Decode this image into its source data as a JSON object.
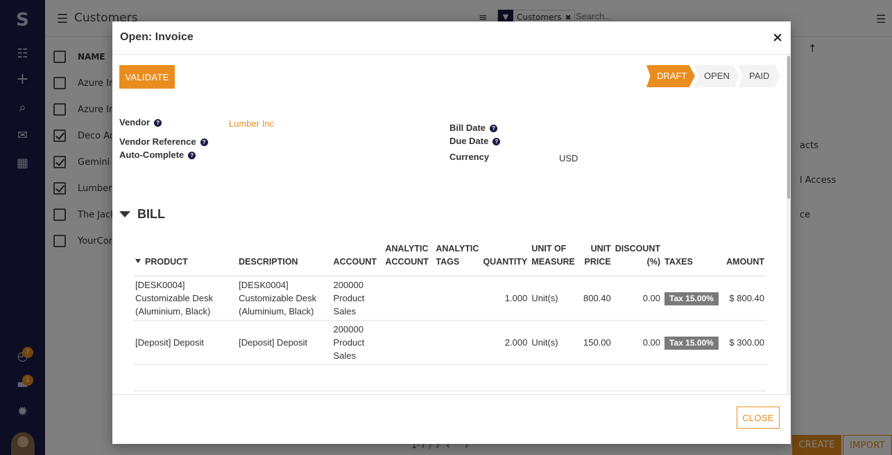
{
  "app": {
    "breadcrumb_title": "Customers",
    "search_facet": "Customers",
    "search_placeholder": "Search...",
    "list": {
      "header": "NAME",
      "rows": [
        {
          "name": "Azure In",
          "checked": false
        },
        {
          "name": "Azure In",
          "checked": false
        },
        {
          "name": "Deco Ad",
          "checked": true
        },
        {
          "name": "Gemini F",
          "checked": true
        },
        {
          "name": "Lumber",
          "checked": true
        },
        {
          "name": "The Jack",
          "checked": false
        },
        {
          "name": "YourCom",
          "checked": false
        }
      ]
    },
    "right_panel": [
      "acts",
      "l Access",
      "ce"
    ],
    "pager": "1-7 / 7",
    "create_label": "CREATE",
    "import_label": "IMPORT",
    "badges": {
      "activity": "7",
      "discuss": "1"
    }
  },
  "modal": {
    "title": "Open: Invoice",
    "validate_label": "VALIDATE",
    "statuses": [
      "DRAFT",
      "OPEN",
      "PAID"
    ],
    "active_status": "DRAFT",
    "fields": {
      "vendor_label": "Vendor",
      "vendor_value": "Lumber Inc",
      "vendor_reference_label": "Vendor Reference",
      "auto_complete_label": "Auto-Complete",
      "bill_date_label": "Bill Date",
      "due_date_label": "Due Date",
      "currency_label": "Currency",
      "currency_value": "USD"
    },
    "section_title": "BILL",
    "table": {
      "headers": {
        "product": "PRODUCT",
        "description": "DESCRIPTION",
        "account": "ACCOUNT",
        "analytic_account_1": "ANALYTIC",
        "analytic_account_2": "ACCOUNT",
        "analytic_tags_1": "ANALYTIC",
        "analytic_tags_2": "TAGS",
        "quantity": "QUANTITY",
        "uom_1": "UNIT OF",
        "uom_2": "MEASURE",
        "unit_price_1": "UNIT",
        "unit_price_2": "PRICE",
        "discount_1": "DISCOUNT",
        "discount_2": "(%)",
        "taxes": "TAXES",
        "amount": "AMOUNT"
      },
      "rows": [
        {
          "product": "[DESK0004] Customizable Desk (Aluminium, Black)",
          "description": "[DESK0004] Customizable Desk (Aluminium, Black)",
          "account": "200000 Product Sales",
          "analytic_account": "",
          "analytic_tags": "",
          "quantity": "1.000",
          "uom": "Unit(s)",
          "unit_price": "800.40",
          "discount": "0.00",
          "tax": "Tax 15.00%",
          "amount": "$ 800.40"
        },
        {
          "product": "[Deposit] Deposit",
          "description": "[Deposit] Deposit",
          "account": "200000 Product Sales",
          "analytic_account": "",
          "analytic_tags": "",
          "quantity": "2.000",
          "uom": "Unit(s)",
          "unit_price": "150.00",
          "discount": "0.00",
          "tax": "Tax 15.00%",
          "amount": "$ 300.00"
        }
      ]
    },
    "close_label": "CLOSE",
    "close_x": "×"
  },
  "icons": {
    "hamburger": "hamburger-icon",
    "sort": "sort-icon",
    "filter": "filter-icon",
    "list_view": "list-view-icon",
    "apps": "apps-icon",
    "plus": "plus-icon",
    "search": "search-icon",
    "mail": "mail-icon",
    "calendar": "calendar-icon",
    "activity": "clock-icon",
    "discuss": "chat-icon",
    "bug": "bug-icon",
    "help": "question-icon"
  },
  "colors": {
    "accent": "#e98d1f",
    "sidebar": "#1a1b48",
    "tax_tag": "#7a7a7a"
  }
}
